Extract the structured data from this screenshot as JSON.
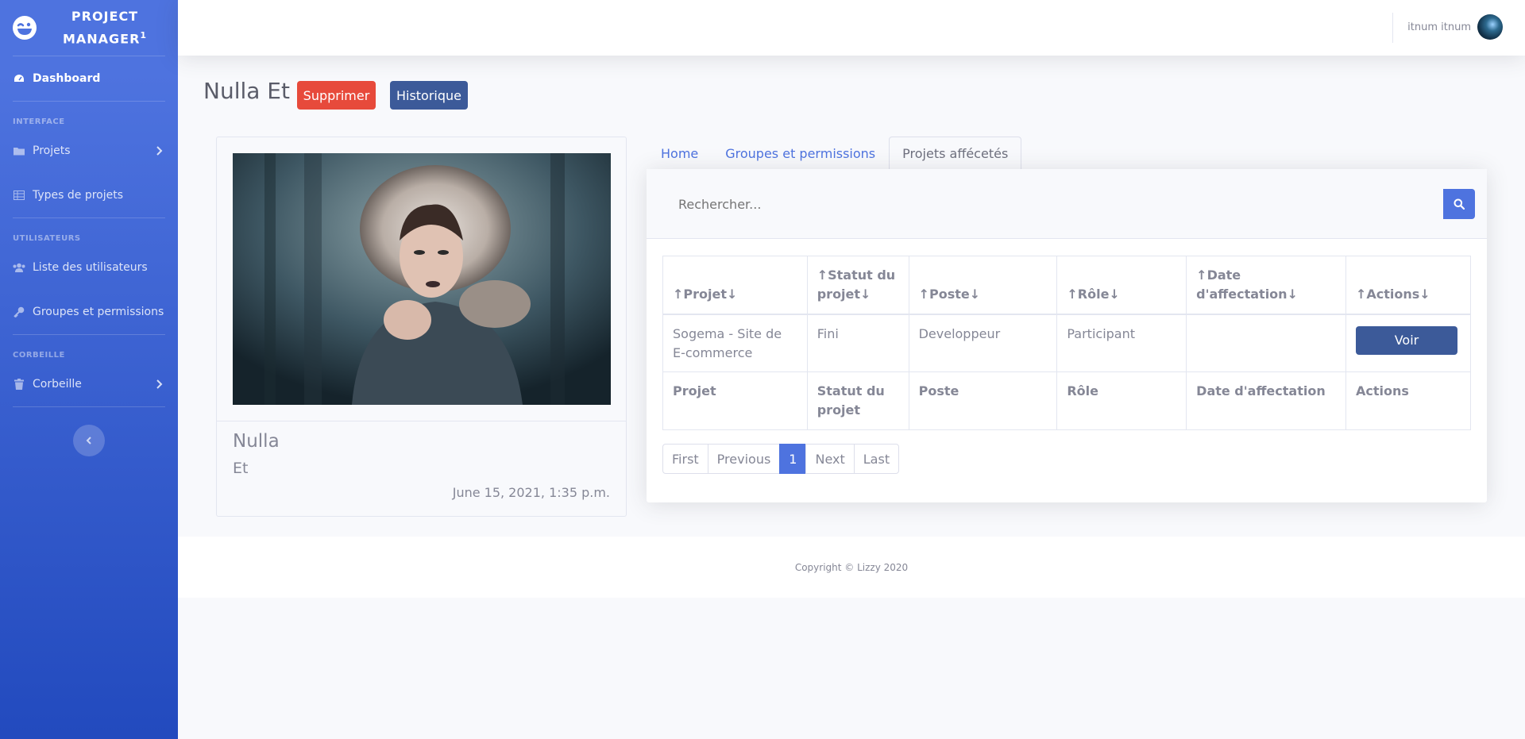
{
  "sidebar": {
    "brand_name": "PROJECT MANAGER",
    "brand_sup": "1",
    "dashboard": "Dashboard",
    "heading_interface": "INTERFACE",
    "projets": "Projets",
    "types_projets": "Types de projets",
    "heading_users": "UTILISATEURS",
    "liste_users": "Liste des utilisateurs",
    "groupes": "Groupes et permissions",
    "heading_trash": "CORBEILLE",
    "corbeille": "Corbeille"
  },
  "topbar": {
    "username": "itnum itnum"
  },
  "page": {
    "title": "Nulla Et",
    "delete_label": "Supprimer",
    "history_label": "Historique"
  },
  "profile": {
    "first_name": "Nulla",
    "last_name": "Et",
    "date": "June 15, 2021, 1:35 p.m."
  },
  "tabs": [
    "Home",
    "Groupes et permissions",
    "Projets affécetés"
  ],
  "search": {
    "placeholder": "Rechercher..."
  },
  "table": {
    "headers": [
      "↑Projet↓",
      "↑Statut du projet↓",
      "↑Poste↓",
      "↑Rôle↓",
      "↑Date d'affectation↓",
      "↑Actions↓"
    ],
    "rows": [
      {
        "projet": "Sogema - Site de E-commerce",
        "statut": "Fini",
        "poste": "Developpeur",
        "role": "Participant",
        "date": "",
        "action": "Voir"
      }
    ],
    "footers": [
      "Projet",
      "Statut du projet",
      "Poste",
      "Rôle",
      "Date d'affectation",
      "Actions"
    ]
  },
  "pagination": {
    "first": "First",
    "previous": "Previous",
    "current": "1",
    "next": "Next",
    "last": "Last"
  },
  "footer": {
    "copyright": "Copyright © Lizzy 2020"
  }
}
